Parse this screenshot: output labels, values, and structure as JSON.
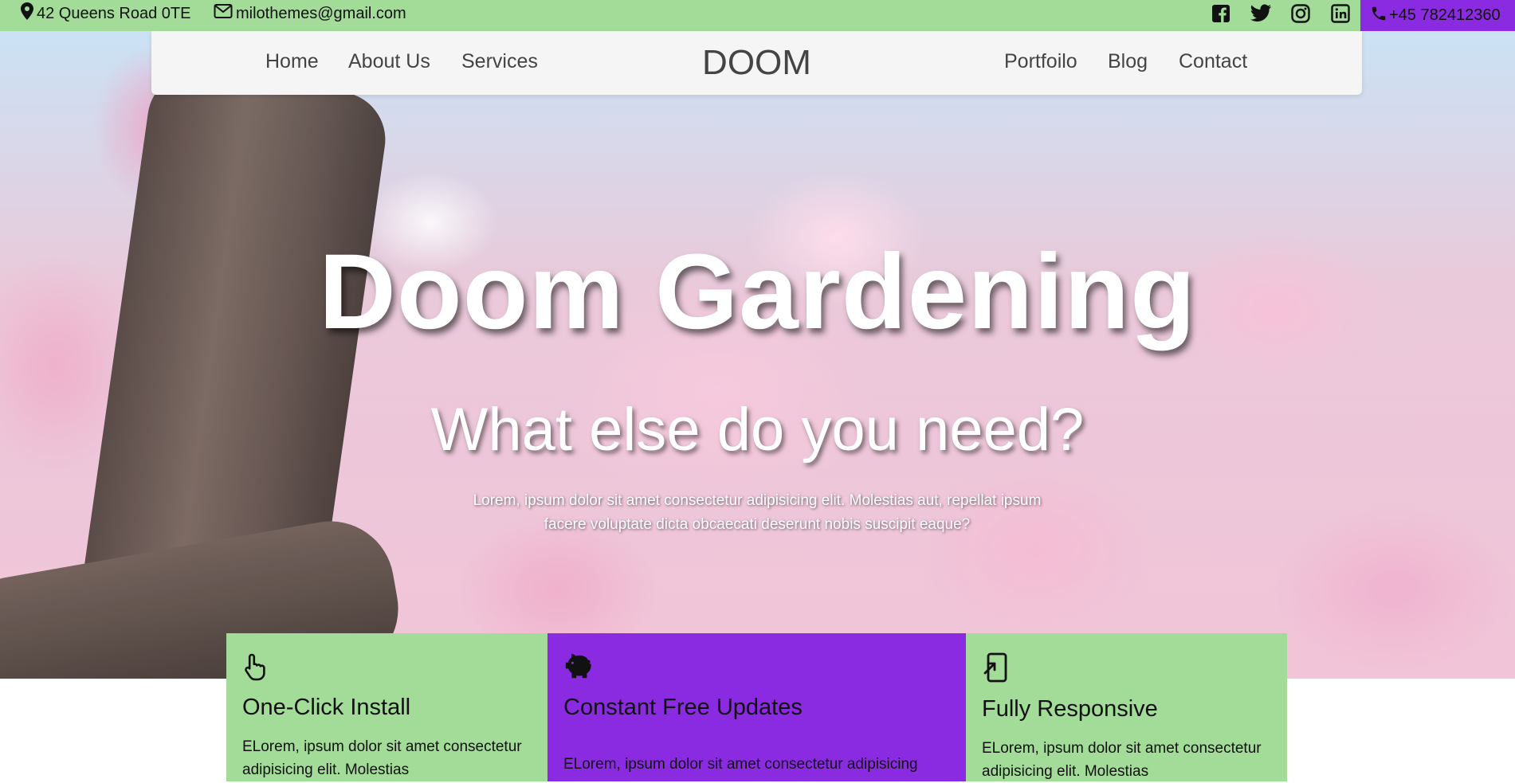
{
  "topbar": {
    "address": "42 Queens Road 0TE",
    "email": "milothemes@gmail.com",
    "phone": "+45 782412360",
    "socials": [
      "facebook",
      "twitter",
      "instagram",
      "linkedin"
    ],
    "bg_color": "#a2dc98",
    "phone_bg_color": "#8a2be2"
  },
  "nav": {
    "brand": "DOOM",
    "left_items": [
      "Home",
      "About Us",
      "Services"
    ],
    "right_items": [
      "Portfoilo",
      "Blog",
      "Contact"
    ]
  },
  "hero": {
    "title": "Doom Gardening",
    "subtitle": "What else do you need?",
    "text": "Lorem, ipsum dolor sit amet consectetur adipisicing elit. Molestias aut, repellat ipsum facere voluptate dicta obcaecati deserunt nobis suscipit eaque?"
  },
  "features": [
    {
      "icon": "pointer-hand-icon",
      "title": "One-Click Install",
      "text": "ELorem, ipsum dolor sit amet consectetur adipisicing elit. Molestias"
    },
    {
      "icon": "piggy-bank-icon",
      "title": "Constant Free Updates",
      "text": "ELorem, ipsum dolor sit amet consectetur adipisicing"
    },
    {
      "icon": "mobile-icon",
      "title": "Fully Responsive",
      "text": "ELorem, ipsum dolor sit amet consectetur adipisicing elit. Molestias"
    }
  ]
}
